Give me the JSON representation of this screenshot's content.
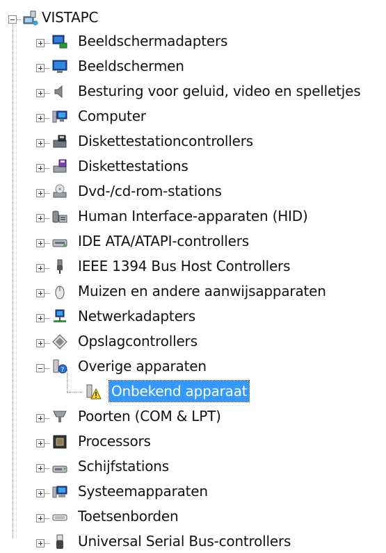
{
  "root": {
    "label": "VISTAPC",
    "icon": "computer-network-icon",
    "expanded": true
  },
  "categories": [
    {
      "label": "Beeldschermadapters",
      "icon": "display-adapter-icon",
      "expanded": false
    },
    {
      "label": "Beeldschermen",
      "icon": "monitor-icon",
      "expanded": false
    },
    {
      "label": "Besturing voor geluid, video en spelletjes",
      "icon": "speaker-icon",
      "expanded": false
    },
    {
      "label": "Computer",
      "icon": "computer-icon",
      "expanded": false
    },
    {
      "label": "Diskettestationcontrollers",
      "icon": "floppy-controller-icon",
      "expanded": false
    },
    {
      "label": "Diskettestations",
      "icon": "floppy-drive-icon",
      "expanded": false
    },
    {
      "label": "Dvd-/cd-rom-stations",
      "icon": "cdrom-drive-icon",
      "expanded": false
    },
    {
      "label": "Human Interface-apparaten (HID)",
      "icon": "hid-device-icon",
      "expanded": false
    },
    {
      "label": "IDE ATA/ATAPI-controllers",
      "icon": "ide-controller-icon",
      "expanded": false
    },
    {
      "label": "IEEE 1394 Bus Host Controllers",
      "icon": "firewire-plug-icon",
      "expanded": false
    },
    {
      "label": "Muizen en andere aanwijsapparaten",
      "icon": "mouse-icon",
      "expanded": false
    },
    {
      "label": "Netwerkadapters",
      "icon": "network-adapter-icon",
      "expanded": false
    },
    {
      "label": "Opslagcontrollers",
      "icon": "storage-controller-icon",
      "expanded": false
    },
    {
      "label": "Overige apparaten",
      "icon": "unknown-device-icon",
      "expanded": true,
      "children": [
        {
          "label": "Onbekend apparaat",
          "icon": "warning-device-icon",
          "selected": true
        }
      ]
    },
    {
      "label": "Poorten (COM & LPT)",
      "icon": "port-icon",
      "expanded": false
    },
    {
      "label": "Processors",
      "icon": "processor-icon",
      "expanded": false
    },
    {
      "label": "Schijfstations",
      "icon": "disk-drive-icon",
      "expanded": false
    },
    {
      "label": "Systeemapparaten",
      "icon": "system-device-icon",
      "expanded": false
    },
    {
      "label": "Toetsenborden",
      "icon": "keyboard-icon",
      "expanded": false
    },
    {
      "label": "Universal Serial Bus-controllers",
      "icon": "usb-plug-icon",
      "expanded": false
    }
  ],
  "colors": {
    "selection": "#3399ff",
    "selection_text": "#ffffff",
    "tree_line": "#8c8c8c"
  }
}
